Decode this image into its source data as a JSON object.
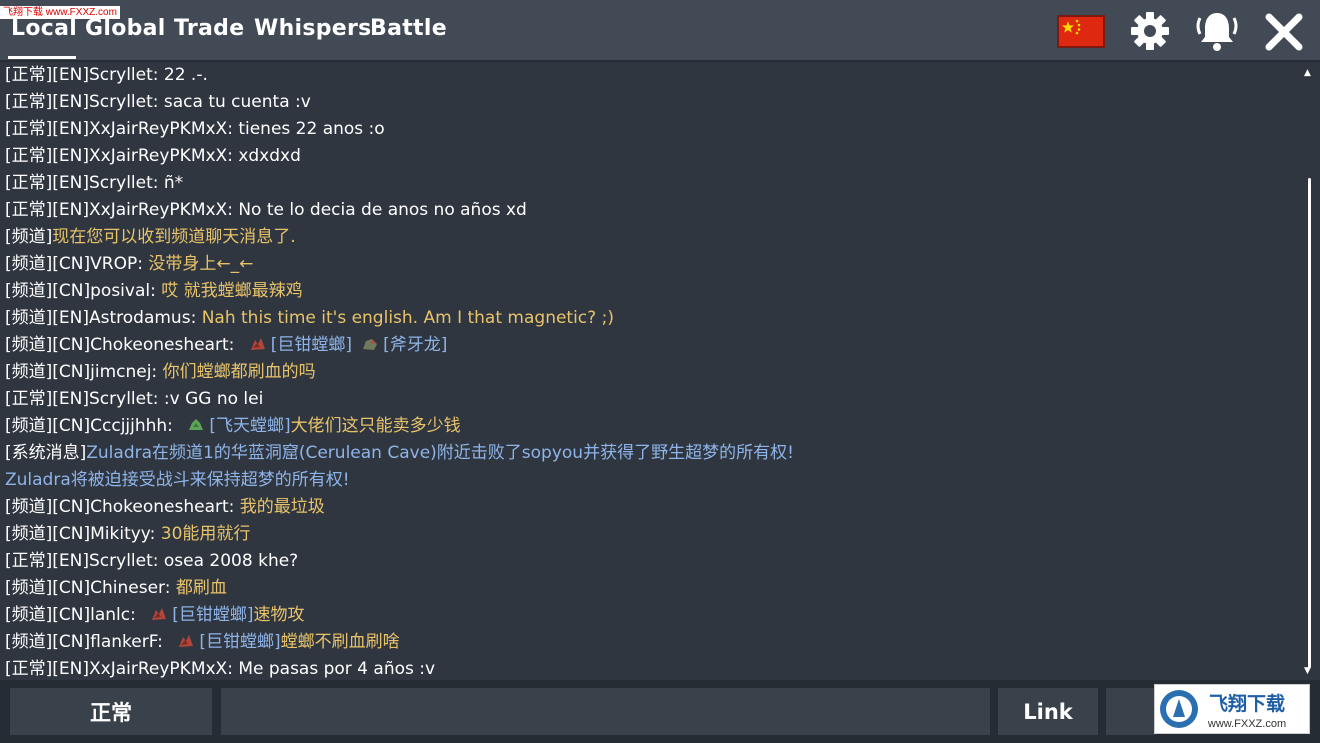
{
  "watermark_top": "飞翔下载 www.FXXZ.com",
  "tabs": [
    {
      "label": "Local"
    },
    {
      "label": "Global"
    },
    {
      "label": "Trade"
    },
    {
      "label": "Whispers"
    },
    {
      "label": "Battle"
    }
  ],
  "active_tab": "Local",
  "icons": {
    "flag": "china-flag-icon",
    "settings": "gear-icon",
    "notifications": "bell-icon",
    "close": "close-icon"
  },
  "colors": {
    "body_yellow": "#e8c36a",
    "body_blue": "#8fb4e8",
    "background": "#2f3640",
    "topbar": "#414a55"
  },
  "messages": [
    {
      "tag": "[正常][EN]",
      "sender": "Scryllet: ",
      "body": "22 .-.",
      "color": "white"
    },
    {
      "tag": "[正常][EN]",
      "sender": "Scryllet: ",
      "body": "saca tu cuenta :v",
      "color": "white"
    },
    {
      "tag": "[正常][EN]",
      "sender": "XxJairReyPKMxX: ",
      "body": "tienes 22 anos :o",
      "color": "white"
    },
    {
      "tag": "[正常][EN]",
      "sender": "XxJairReyPKMxX: ",
      "body": "xdxdxd",
      "color": "white"
    },
    {
      "tag": "[正常][EN]",
      "sender": "Scryllet: ",
      "body": "ñ*",
      "color": "white"
    },
    {
      "tag": "[正常][EN]",
      "sender": "XxJairReyPKMxX: ",
      "body": "No te lo decia de anos no años xd",
      "color": "white"
    },
    {
      "tag": "[频道]",
      "sender": "",
      "body": "现在您可以收到频道聊天消息了.",
      "color": "yellow"
    },
    {
      "tag": "[频道][CN]",
      "sender": "VROP: ",
      "body": "没带身上←_←",
      "color": "yellow"
    },
    {
      "tag": "[频道][CN]",
      "sender": "posival: ",
      "body": "哎 就我螳螂最辣鸡",
      "color": "yellow"
    },
    {
      "tag": "[频道][EN]",
      "sender": "Astrodamus: ",
      "body": "Nah this time it's english. Am I that magnetic? ;)",
      "color": "yellow"
    },
    {
      "tag": "[频道][CN]",
      "sender": "Chokeonesheart: ",
      "refs": [
        "[巨钳螳螂]",
        "[斧牙龙]"
      ],
      "body": "",
      "color": "yellow"
    },
    {
      "tag": "[频道][CN]",
      "sender": "jimcnej: ",
      "body": "你们螳螂都刷血的吗",
      "color": "yellow"
    },
    {
      "tag": "[正常][EN]",
      "sender": "Scryllet: ",
      "body": ":v GG no lei",
      "color": "white"
    },
    {
      "tag": "[频道][CN]",
      "sender": "Cccjjjhhh: ",
      "refs": [
        "[飞天螳螂]"
      ],
      "body": "大佬们这只能卖多少钱",
      "color": "yellow"
    },
    {
      "tag": "[系统消息]",
      "sender": "",
      "body": "Zuladra在频道1的华蓝洞窟(Cerulean Cave)附近击败了sopyou并获得了野生超梦的所有权!",
      "color": "blue"
    },
    {
      "tag": "",
      "sender": "",
      "body": "Zuladra将被迫接受战斗来保持超梦的所有权!",
      "color": "blue"
    },
    {
      "tag": "[频道][CN]",
      "sender": "Chokeonesheart: ",
      "body": "我的最垃圾",
      "color": "yellow"
    },
    {
      "tag": "[频道][CN]",
      "sender": "Mikityy: ",
      "body": "30能用就行",
      "color": "yellow"
    },
    {
      "tag": "[正常][EN]",
      "sender": "Scryllet: ",
      "body": "osea 2008 khe?",
      "color": "white"
    },
    {
      "tag": "[频道][CN]",
      "sender": "Chineser: ",
      "body": "都刷血",
      "color": "yellow"
    },
    {
      "tag": "[频道][CN]",
      "sender": "lanlc: ",
      "refs": [
        "[巨钳螳螂]"
      ],
      "body": "速物攻",
      "color": "yellow"
    },
    {
      "tag": "[频道][CN]",
      "sender": "flankerF: ",
      "refs": [
        "[巨钳螳螂]"
      ],
      "body": "螳螂不刷血刷啥",
      "color": "yellow"
    },
    {
      "tag": "[正常][EN]",
      "sender": "XxJairReyPKMxX: ",
      "body": "Me pasas por 4 años :v",
      "color": "white"
    }
  ],
  "bottom": {
    "channel_label": "正常",
    "input_value": "",
    "link_label": "Link"
  },
  "watermark_bottom": {
    "text": "飞翔下载",
    "url": "www.FXXZ.com"
  }
}
